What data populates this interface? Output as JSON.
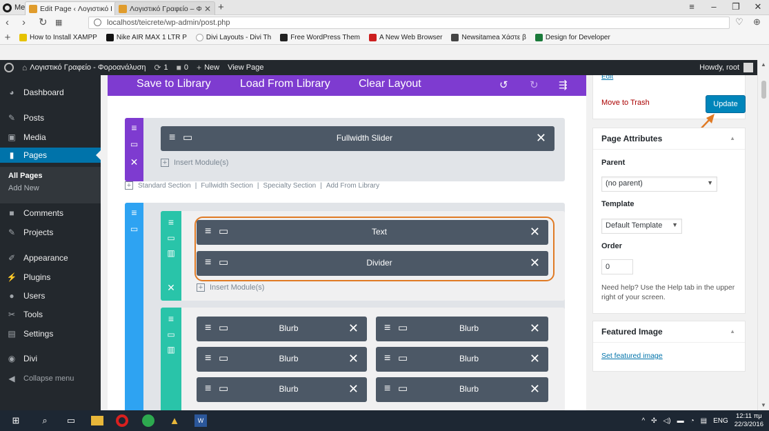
{
  "browser": {
    "menu_label": "Menu",
    "tabs": [
      {
        "title": "Edit Page ‹ Λογιστικό Γραφείο"
      },
      {
        "title": "Λογιστικό Γραφείο – Φοροανάλυση"
      }
    ],
    "url": "localhost/teicrete/wp-admin/post.php",
    "bookmarks": [
      {
        "label": "How to Install XAMPP",
        "color": "#e6c200"
      },
      {
        "label": "Nike AIR MAX 1 LTR P",
        "color": "#111111"
      },
      {
        "label": "Divi Layouts - Divi Th",
        "color": "#bbbbbb"
      },
      {
        "label": "Free WordPress Them",
        "color": "#222222"
      },
      {
        "label": "A New Web Browser",
        "color": "#cc1f1f"
      },
      {
        "label": "Newsitamea Χάστε β",
        "color": "#444444"
      },
      {
        "label": "Design for Developer",
        "color": "#1a7a3a"
      }
    ]
  },
  "adminbar": {
    "site_name": "Λογιστικό Γραφείο - Φοροανάλυση",
    "updates_count": "1",
    "comments_count": "0",
    "new_label": "New",
    "view_label": "View Page",
    "howdy": "Howdy, root"
  },
  "sidebar": {
    "items": [
      {
        "label": "Dashboard"
      },
      {
        "label": "Posts"
      },
      {
        "label": "Media"
      },
      {
        "label": "Pages"
      },
      {
        "label": "Comments"
      },
      {
        "label": "Projects"
      },
      {
        "label": "Appearance"
      },
      {
        "label": "Plugins"
      },
      {
        "label": "Users"
      },
      {
        "label": "Tools"
      },
      {
        "label": "Settings"
      },
      {
        "label": "Divi"
      },
      {
        "label": "Collapse menu"
      }
    ],
    "submenu": [
      "All Pages",
      "Add New"
    ]
  },
  "builder": {
    "toolbar": {
      "save": "Save to Library",
      "load": "Load From Library",
      "clear": "Clear Layout"
    },
    "colors": {
      "purple": "#7e3bd0",
      "blue": "#2ea3f2",
      "teal": "#29c4a9",
      "module": "#4c5866",
      "highlight": "#e07a24"
    },
    "fullwidth_module": "Fullwidth Slider",
    "insert_module": "Insert Module(s)",
    "section_links": [
      "Standard Section",
      "Fullwidth Section",
      "Specialty Section",
      "Add From Library"
    ],
    "row1_modules": [
      "Text",
      "Divider"
    ],
    "row2_blurbs": [
      "Blurb",
      "Blurb",
      "Blurb",
      "Blurb",
      "Blurb",
      "Blurb"
    ]
  },
  "publish": {
    "edit": "Edit",
    "trash": "Move to Trash",
    "update": "Update"
  },
  "page_attributes": {
    "title": "Page Attributes",
    "parent_label": "Parent",
    "parent_value": "(no parent)",
    "template_label": "Template",
    "template_value": "Default Template",
    "order_label": "Order",
    "order_value": "0",
    "help": "Need help? Use the Help tab in the upper right of your screen."
  },
  "featured_image": {
    "title": "Featured Image",
    "link": "Set featured image"
  },
  "taskbar": {
    "lang": "ENG",
    "time": "12:11 πμ",
    "date": "22/3/2016"
  }
}
